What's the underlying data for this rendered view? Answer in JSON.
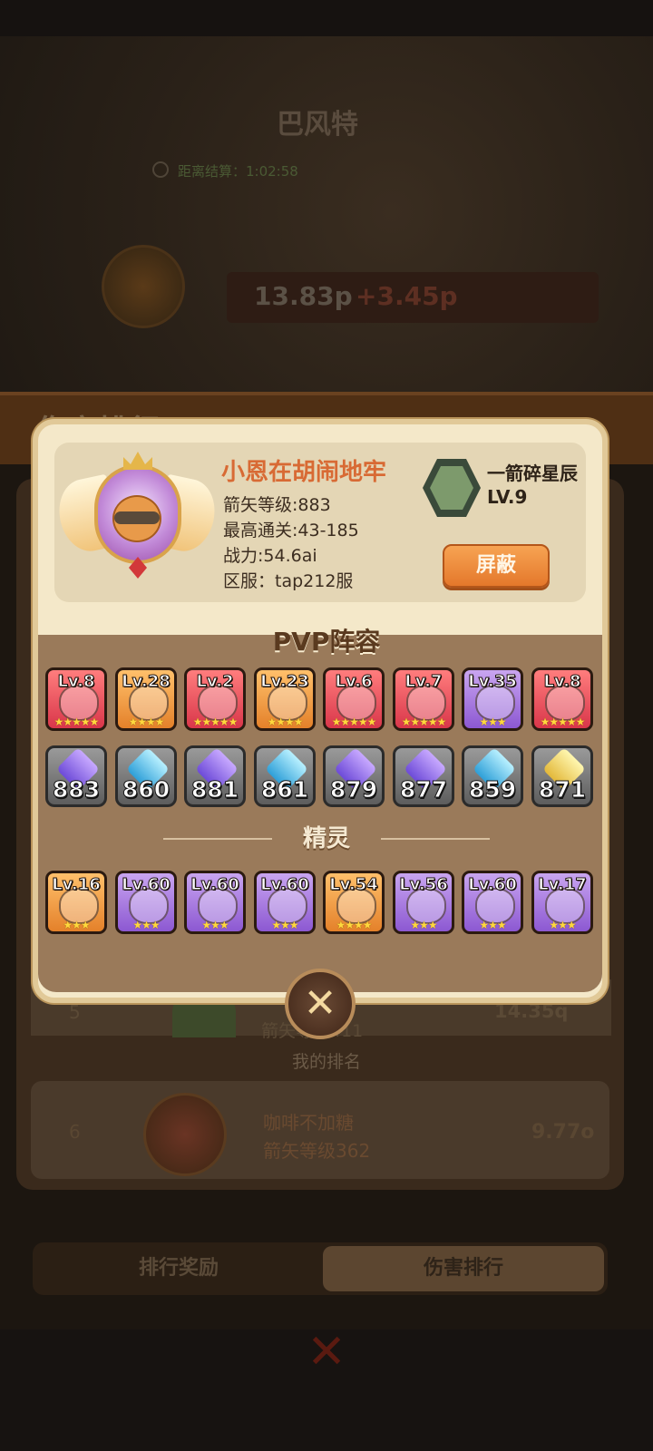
{
  "background": {
    "boss_name": "巴风特",
    "boss_timer": "距离结算：1:02:58",
    "boss_hp": "13.83p",
    "boss_hp_add": "+3.45p",
    "header_title": "伤害排行",
    "rank5": {
      "rank": "5",
      "value": "14.35q",
      "sub": "箭矢等级411"
    },
    "my_rank_label": "我的排名",
    "my_rank": {
      "rank": "6",
      "name": "咖啡不加糖",
      "level": "箭矢等级362",
      "value": "9.77o"
    },
    "tabs": {
      "left": "排行奖励",
      "right": "伤害排行"
    },
    "bottom_close": "✕"
  },
  "profile": {
    "name": "小恩在胡闹地牢",
    "arrow_level": "箭矢等级:883",
    "best_stage": "最高通关:43-185",
    "power": "战力:54.6ai",
    "server": "区服：tap212服",
    "title_name": "一箭碎星辰",
    "title_level": "LV.9",
    "block_label": "屏蔽"
  },
  "pvp_title": "PVP阵容",
  "heroes": [
    {
      "lv": "Lv.8",
      "stars": "★★★★★",
      "color": "red"
    },
    {
      "lv": "Lv.28",
      "stars": "★★★★",
      "color": "orange"
    },
    {
      "lv": "Lv.2",
      "stars": "★★★★★",
      "color": "red"
    },
    {
      "lv": "Lv.23",
      "stars": "★★★★",
      "color": "orange"
    },
    {
      "lv": "Lv.6",
      "stars": "★★★★★",
      "color": "red"
    },
    {
      "lv": "Lv.7",
      "stars": "★★★★★",
      "color": "red"
    },
    {
      "lv": "Lv.35",
      "stars": "★★★",
      "color": "purple"
    },
    {
      "lv": "Lv.8",
      "stars": "★★★★★",
      "color": "red"
    }
  ],
  "weapons": [
    {
      "level": "883",
      "glow": "violet"
    },
    {
      "level": "860",
      "glow": "cyan"
    },
    {
      "level": "881",
      "glow": "violet"
    },
    {
      "level": "861",
      "glow": "cyan"
    },
    {
      "level": "879",
      "glow": "violet"
    },
    {
      "level": "877",
      "glow": "violet"
    },
    {
      "level": "859",
      "glow": "cyan"
    },
    {
      "level": "871",
      "glow": "gold"
    }
  ],
  "sprite_title": "精灵",
  "sprites": [
    {
      "lv": "Lv.16",
      "stars": "★★★",
      "color": "orange"
    },
    {
      "lv": "Lv.60",
      "stars": "★★★",
      "color": "purple"
    },
    {
      "lv": "Lv.60",
      "stars": "★★★",
      "color": "purple"
    },
    {
      "lv": "Lv.60",
      "stars": "★★★",
      "color": "purple"
    },
    {
      "lv": "Lv.54",
      "stars": "★★★★",
      "color": "orange"
    },
    {
      "lv": "Lv.56",
      "stars": "★★★",
      "color": "purple"
    },
    {
      "lv": "Lv.60",
      "stars": "★★★",
      "color": "purple"
    },
    {
      "lv": "Lv.17",
      "stars": "★★★",
      "color": "purple"
    }
  ],
  "close_label": "✕"
}
